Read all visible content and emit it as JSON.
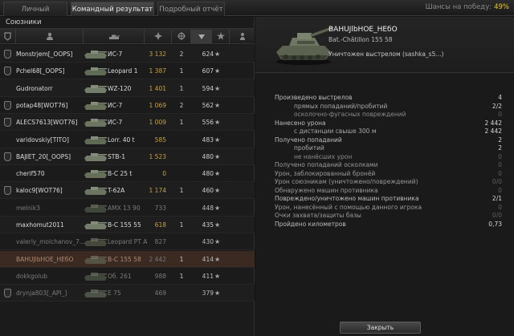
{
  "tabs": [
    {
      "label": "Личный результат"
    },
    {
      "label": "Командный результат"
    },
    {
      "label": "Подробный отчёт"
    }
  ],
  "win_chance": {
    "label": "Шансы на победу:",
    "value": "49%"
  },
  "allies": {
    "title": "Союзники",
    "columns": [
      {
        "icon": "clan-icon"
      },
      {
        "icon": "player-icon"
      },
      {
        "icon": "tank-icon"
      },
      {
        "icon": "damage-icon"
      },
      {
        "icon": "kills-icon"
      },
      {
        "icon": "sort-arrow-icon"
      },
      {
        "icon": "star-icon"
      },
      {
        "icon": "squad-icon"
      }
    ],
    "rows": [
      {
        "player": "Monstrjem[_OOPS]",
        "vehicle": "ИС-7",
        "damage": "3 132",
        "kills": "2",
        "xp": "624",
        "clan": true,
        "dead": false
      },
      {
        "player": "Pchel68[_OOPS]",
        "vehicle": "Leopard 1",
        "damage": "1 387",
        "kills": "1",
        "xp": "607",
        "clan": true,
        "dead": false
      },
      {
        "player": "Gudronatorr",
        "vehicle": "WZ-120",
        "damage": "1 401",
        "kills": "1",
        "xp": "594",
        "clan": false,
        "dead": false
      },
      {
        "player": "potap48[WOT76]",
        "vehicle": "ИС-7",
        "damage": "1 069",
        "kills": "2",
        "xp": "562",
        "clan": true,
        "dead": false
      },
      {
        "player": "ALECS7613[WOT76]",
        "vehicle": "ИС-7",
        "damage": "1 009",
        "kills": "1",
        "xp": "556",
        "clan": true,
        "dead": false
      },
      {
        "player": "varidovskiy[TITO]",
        "vehicle": "Lorr. 40 t",
        "damage": "585",
        "kills": "",
        "xp": "483",
        "clan": false,
        "dead": false
      },
      {
        "player": "BAJIET_20[_OOPS]",
        "vehicle": "STB-1",
        "damage": "1 523",
        "kills": "",
        "xp": "480",
        "clan": true,
        "dead": false
      },
      {
        "player": "cherif570",
        "vehicle": "B-C 25 t",
        "damage": "0",
        "kills": "",
        "xp": "480",
        "clan": false,
        "dead": false
      },
      {
        "player": "kaloc9[WOT76]",
        "vehicle": "T-62A",
        "damage": "1 174",
        "kills": "1",
        "xp": "460",
        "clan": true,
        "dead": false
      },
      {
        "player": "melnik3",
        "vehicle": "AMX 13 90",
        "damage": "733",
        "kills": "",
        "xp": "448",
        "clan": false,
        "dead": true
      },
      {
        "player": "maxhomut2011",
        "vehicle": "B-C 155 55",
        "damage": "618",
        "kills": "1",
        "xp": "435",
        "clan": false,
        "dead": false
      },
      {
        "player": "valeriy_molchanov_7...",
        "vehicle": "Leopard PT A",
        "damage": "827",
        "kills": "",
        "xp": "430",
        "clan": false,
        "dead": true
      },
      {
        "player": "BAHUJlbHOE_HEбO",
        "vehicle": "B-C 155 58",
        "damage": "2 442",
        "kills": "1",
        "xp": "414",
        "clan": false,
        "dead": true,
        "me": true
      },
      {
        "player": "dokkgolub",
        "vehicle": "Об. 261",
        "damage": "988",
        "kills": "1",
        "xp": "411",
        "clan": false,
        "dead": true
      },
      {
        "player": "drynja803[_API_]",
        "vehicle": "E 75",
        "damage": "469",
        "kills": "",
        "xp": "379",
        "clan": true,
        "dead": true
      }
    ]
  },
  "detail": {
    "player": "BAHUJlbHOE_HEбO",
    "vehicle": "Bat.-Châtillon 155 58",
    "status": "Уничтожен выстрелом (sashka_s5...)",
    "stats": [
      {
        "label": "Произведено выстрелов",
        "value": "4",
        "sub": false
      },
      {
        "label": "прямых попаданий/пробитий",
        "value": "2/2",
        "sub": true
      },
      {
        "label": "осколочно-фугасных повреждений",
        "value": "0",
        "sub": true
      },
      {
        "label": "Нанесено урона",
        "value": "2 442",
        "sub": false
      },
      {
        "label": "с дистанции свыше 300 м",
        "value": "2 442",
        "sub": true
      },
      {
        "label": "Получено попаданий",
        "value": "2",
        "sub": false
      },
      {
        "label": "пробитий",
        "value": "2",
        "sub": true
      },
      {
        "label": "не нанёсших урон",
        "value": "0",
        "sub": true
      },
      {
        "label": "Получено попаданий осколками",
        "value": "0",
        "sub": false
      },
      {
        "label": "Урон, заблокированный бронёй",
        "value": "0",
        "sub": false
      },
      {
        "label": "Урон союзникам (уничтожено/повреждений)",
        "value": "0/0",
        "sub": false
      },
      {
        "label": "Обнаружено машин противника",
        "value": "0",
        "sub": false
      },
      {
        "label": "Повреждено/уничтожено машин противника",
        "value": "2/1",
        "sub": false
      },
      {
        "label": "Урон, нанесённый с помощью данного игрока",
        "value": "0",
        "sub": false
      },
      {
        "label": "Очки захвата/защиты базы",
        "value": "0/0",
        "sub": false
      },
      {
        "label": "Пройдено километров",
        "value": "0,73",
        "sub": false
      }
    ]
  },
  "close_button": {
    "label": "Закрыть"
  },
  "colors": {
    "damage": "#c8a23c",
    "win_pct": "#e8c83a",
    "self_row": "#3a2a22"
  }
}
